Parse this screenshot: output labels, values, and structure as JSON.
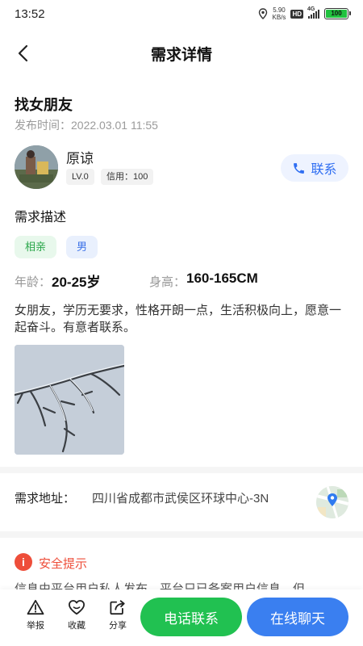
{
  "status_bar": {
    "time": "13:52",
    "net_speed_value": "5.90",
    "net_speed_unit": "KB/s",
    "hd": "HD",
    "network": "4G",
    "battery": "100"
  },
  "nav": {
    "title": "需求详情"
  },
  "post": {
    "title": "找女朋友",
    "publish_time": "发布时间：2022.03.01 11:55"
  },
  "user": {
    "name": "原谅",
    "level": "LV.0",
    "credit": "信用：100",
    "contact_label": "联系"
  },
  "requirement": {
    "section_title": "需求描述",
    "tags": [
      "相亲",
      "男"
    ],
    "age_label": "年龄：",
    "age_value": "20-25岁",
    "height_label": "身高：",
    "height_value": "160-165CM",
    "description": "女朋友，学历无要求，性格开朗一点，生活积极向上，愿意一起奋斗。有意者联系。"
  },
  "address": {
    "label": "需求地址：",
    "value": "四川省成都市武侯区环球中心-3N"
  },
  "safety": {
    "title": "安全提示",
    "text": "信息由平台用户私人发布，平台只已备案用户信息，但"
  },
  "bottom_bar": {
    "report": "举报",
    "favorite": "收藏",
    "share": "分享",
    "call_button": "电话联系",
    "chat_button": "在线聊天"
  },
  "colors": {
    "green": "#21c151",
    "blue": "#3a7ff0",
    "danger": "#ee4e3a"
  }
}
